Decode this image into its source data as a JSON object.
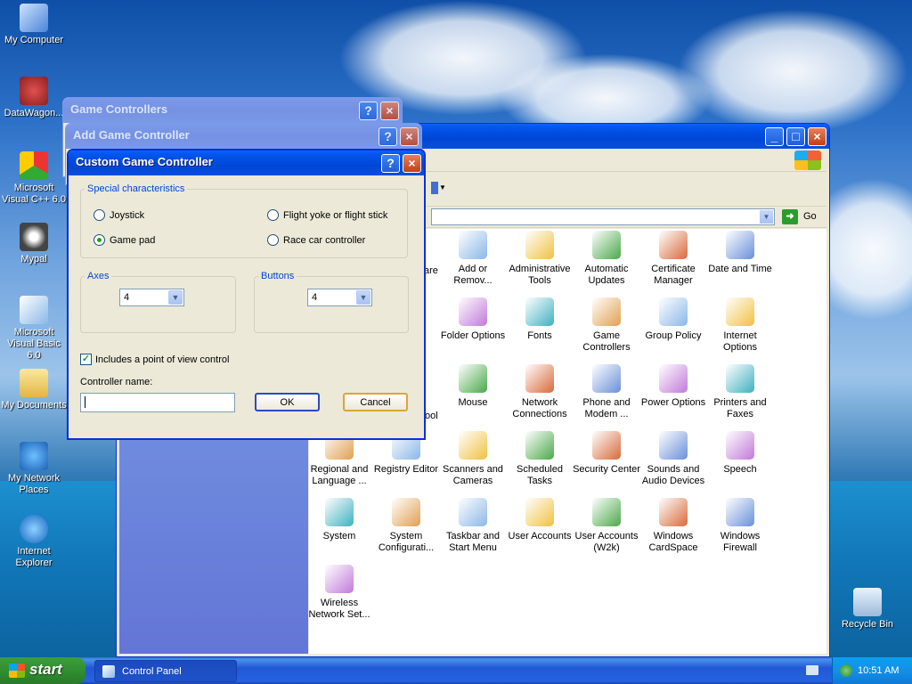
{
  "desktop": {
    "icons": [
      {
        "label": "My Computer",
        "icon": "my-computer-icon"
      },
      {
        "label": "DataWagon...",
        "icon": "datawagon-icon"
      },
      {
        "label": "Microsoft Visual C++ 6.0",
        "icon": "visual-cpp-icon"
      },
      {
        "label": "Mypal",
        "icon": "mypal-icon"
      },
      {
        "label": "Microsoft Visual Basic 6.0",
        "icon": "visual-basic-icon"
      },
      {
        "label": "My Documents",
        "icon": "my-documents-icon"
      },
      {
        "label": "My Network Places",
        "icon": "network-places-icon"
      },
      {
        "label": "Internet Explorer",
        "icon": "internet-explorer-icon"
      },
      {
        "label": "Recycle Bin",
        "icon": "recycle-bin-icon"
      }
    ]
  },
  "control_panel": {
    "go_label": "Go",
    "items": [
      {
        "label": "Add or Remov...",
        "icon": "add-remove-icon"
      },
      {
        "label": "Administrative Tools",
        "icon": "admin-tools-icon"
      },
      {
        "label": "Automatic Updates",
        "icon": "auto-updates-icon"
      },
      {
        "label": "Certificate Manager",
        "icon": "certificate-icon"
      },
      {
        "label": "Date and Time",
        "icon": "date-time-icon"
      },
      {
        "label": "Folder Options",
        "icon": "folder-options-icon"
      },
      {
        "label": "Fonts",
        "icon": "fonts-icon"
      },
      {
        "label": "Game Controllers",
        "icon": "game-controllers-icon"
      },
      {
        "label": "Group Policy",
        "icon": "group-policy-icon"
      },
      {
        "label": "Internet Options",
        "icon": "internet-options-icon"
      },
      {
        "label": "Mouse",
        "icon": "mouse-icon"
      },
      {
        "label": "Network Connections",
        "icon": "network-connections-icon"
      },
      {
        "label": "Phone and Modem ...",
        "icon": "phone-modem-icon"
      },
      {
        "label": "Power Options",
        "icon": "power-options-icon"
      },
      {
        "label": "Printers and Faxes",
        "icon": "printers-icon"
      },
      {
        "label": "Regional and Language ...",
        "icon": "regional-icon"
      },
      {
        "label": "Registry Editor",
        "icon": "registry-icon"
      },
      {
        "label": "Scanners and Cameras",
        "icon": "scanners-icon"
      },
      {
        "label": "Scheduled Tasks",
        "icon": "scheduled-tasks-icon"
      },
      {
        "label": "Security Center",
        "icon": "security-center-icon"
      },
      {
        "label": "Sounds and Audio Devices",
        "icon": "sounds-icon"
      },
      {
        "label": "Speech",
        "icon": "speech-icon"
      },
      {
        "label": "System",
        "icon": "system-icon"
      },
      {
        "label": "System Configurati...",
        "icon": "system-config-icon"
      },
      {
        "label": "Taskbar and Start Menu",
        "icon": "taskbar-icon"
      },
      {
        "label": "User Accounts",
        "icon": "user-accounts-icon"
      },
      {
        "label": "User Accounts (W2k)",
        "icon": "user-accounts-w2k-icon"
      },
      {
        "label": "Windows CardSpace",
        "icon": "cardspace-icon"
      },
      {
        "label": "Windows Firewall",
        "icon": "firewall-icon"
      },
      {
        "label": "Wireless Network Set...",
        "icon": "wireless-icon"
      }
    ],
    "partial_labels": [
      "are",
      "ool"
    ]
  },
  "game_controllers": {
    "title": "Game Controllers"
  },
  "add_game_controller": {
    "title": "Add Game Controller"
  },
  "custom_dialog": {
    "title": "Custom Game Controller",
    "special_legend": "Special characteristics",
    "radios": [
      {
        "label": "Joystick",
        "selected": false
      },
      {
        "label": "Game pad",
        "selected": true
      },
      {
        "label": "Flight yoke or flight stick",
        "selected": false
      },
      {
        "label": "Race car controller",
        "selected": false
      }
    ],
    "axes_legend": "Axes",
    "axes_value": "4",
    "buttons_legend": "Buttons",
    "buttons_value": "4",
    "pov_label": "Includes a point of view control",
    "pov_checked": true,
    "controller_name_label": "Controller name:",
    "controller_name_value": "",
    "ok_label": "OK",
    "cancel_label": "Cancel"
  },
  "taskbar": {
    "start_label": "start",
    "task_label": "Control Panel",
    "clock": "10:51 AM"
  },
  "colors": {
    "titlebar": "#0054e3",
    "start": "#3c9e3c",
    "dialog_bg": "#ece9d8"
  }
}
